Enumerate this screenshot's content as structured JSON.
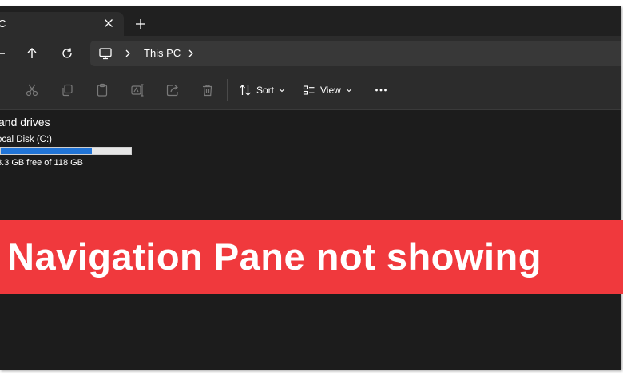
{
  "tab": {
    "title": "C",
    "close_icon": "close-icon",
    "new_tab_icon": "plus-icon"
  },
  "nav": {
    "back_icon": "arrow-left-icon",
    "up_icon": "arrow-up-icon",
    "refresh_icon": "refresh-icon"
  },
  "address": {
    "pc_icon": "monitor-icon",
    "location": "This PC"
  },
  "toolbar": {
    "icons": [
      "cut-icon",
      "copy-icon",
      "paste-icon",
      "rename-icon",
      "share-icon",
      "delete-icon"
    ],
    "sort_label": "Sort",
    "view_label": "View",
    "more_icon": "ellipsis-icon"
  },
  "content": {
    "section_title": "and drives",
    "drive": {
      "name": "ocal Disk (C:)",
      "free_text": "8.3 GB free of 118 GB",
      "used_fraction": 0.7
    }
  },
  "banner": {
    "text": "Navigation Pane not showing",
    "color": "#f0393d"
  },
  "colors": {
    "background": "#1c1c1c",
    "chrome": "#2c2c2c",
    "accent": "#2174d6"
  }
}
